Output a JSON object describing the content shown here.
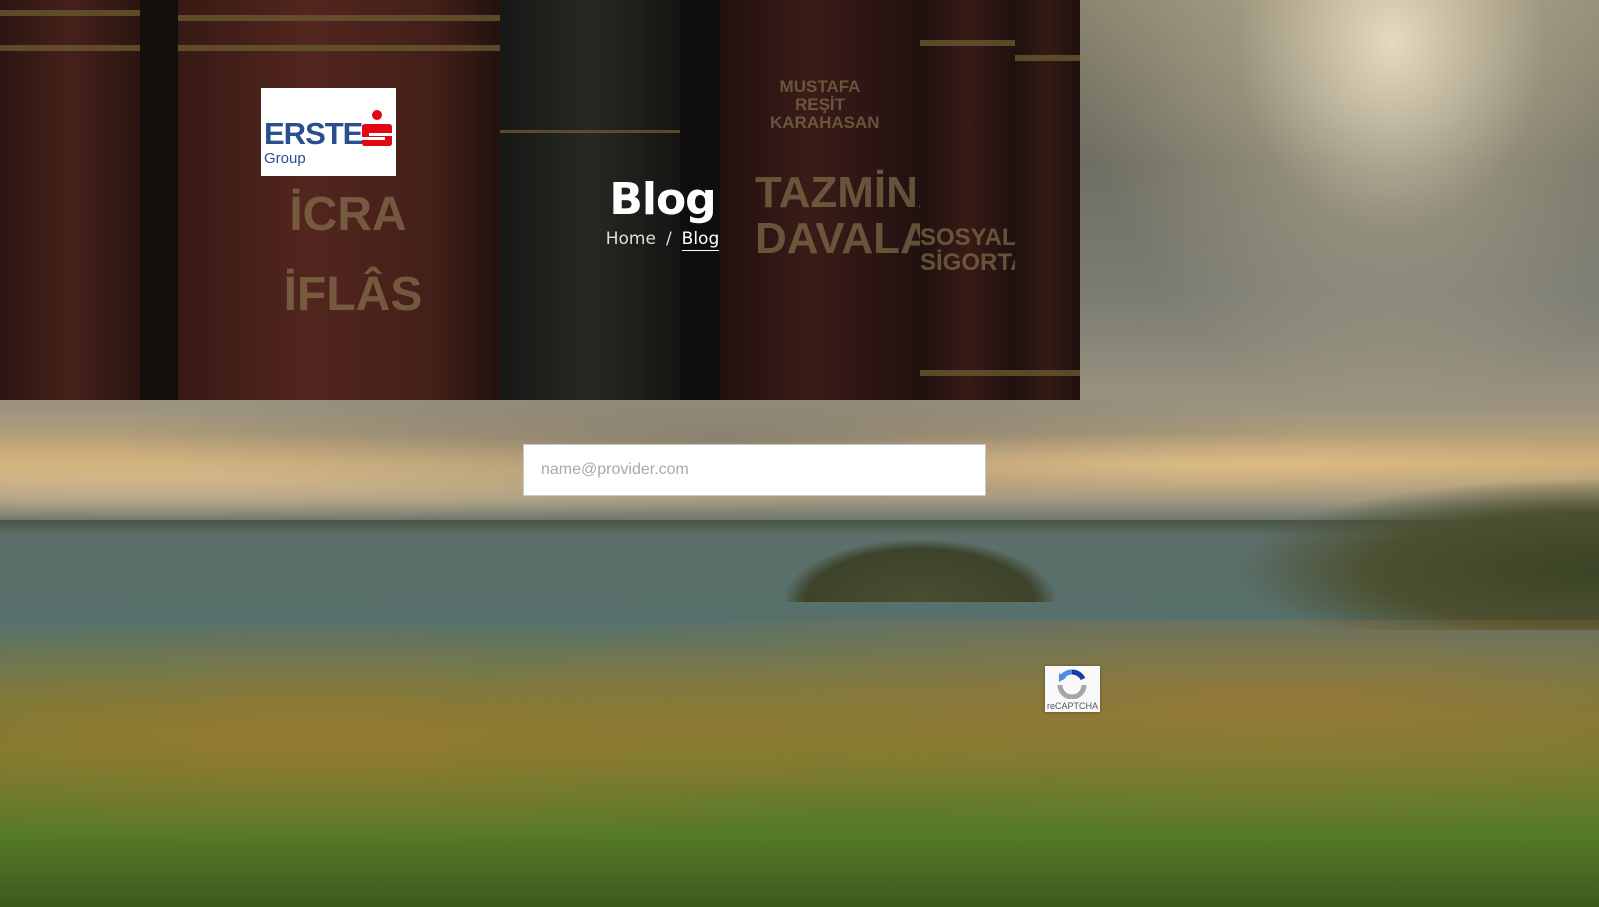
{
  "brand": {
    "logo_word": "ERSTE",
    "logo_sub": "Group",
    "logo_color": "#2a4f8f",
    "logo_mark_color": "#e30613"
  },
  "hero": {
    "title": "Blog",
    "book_spines": [
      "İCRA",
      "İFLÂS",
      "MUSTAFA REŞİT KARAHASAN",
      "TAZMİNAT DAVALARI",
      "SOSYAL SİGORTA"
    ],
    "breadcrumb": {
      "home": "Home",
      "separator": "/",
      "current": "Blog"
    }
  },
  "newsletter": {
    "email_placeholder": "name@provider.com",
    "email_value": ""
  },
  "recaptcha": {
    "label": "reCAPTCHA",
    "icon": "recaptcha-icon"
  }
}
